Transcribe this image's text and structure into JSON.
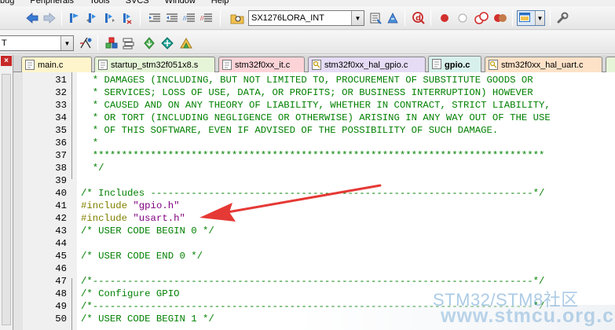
{
  "menu": {
    "items": [
      "bug",
      "Peripherals",
      "Tools",
      "SVCS",
      "Window",
      "Help"
    ]
  },
  "toolbar": {
    "target_combo": "SX1276LORA_INT",
    "left_combo": "T"
  },
  "tabs": [
    {
      "label": "main.c",
      "color": "#fff5cc"
    },
    {
      "label": "startup_stm32f051x8.s",
      "color": "#e6f5d8"
    },
    {
      "label": "stm32f0xx_it.c",
      "color": "#fcd4d8"
    },
    {
      "label": "stm32f0xx_hal_gpio.c",
      "color": "#e6dcf5"
    },
    {
      "label": "gpio.c",
      "color": "#d8f0ec",
      "active": true
    },
    {
      "label": "stm32f0xx_hal_uart.c",
      "color": "#fde2c8"
    }
  ],
  "editor": {
    "lines": [
      {
        "num": "31",
        "segs": [
          {
            "t": "  * DAMAGES (INCLUDING, BUT NOT LIMITED TO, PROCUREMENT OF SUBSTITUTE GOODS OR",
            "c": "comment"
          }
        ]
      },
      {
        "num": "32",
        "segs": [
          {
            "t": "  * SERVICES; LOSS OF USE, DATA, OR PROFITS; OR BUSINESS INTERRUPTION) HOWEVER",
            "c": "comment"
          }
        ]
      },
      {
        "num": "33",
        "segs": [
          {
            "t": "  * CAUSED AND ON ANY THEORY OF LIABILITY, WHETHER IN CONTRACT, STRICT LIABILITY,",
            "c": "comment"
          }
        ]
      },
      {
        "num": "34",
        "segs": [
          {
            "t": "  * OR TORT (INCLUDING NEGLIGENCE OR OTHERWISE) ARISING IN ANY WAY OUT OF THE USE",
            "c": "comment"
          }
        ]
      },
      {
        "num": "35",
        "segs": [
          {
            "t": "  * OF THIS SOFTWARE, EVEN IF ADVISED OF THE POSSIBILITY OF SUCH DAMAGE.",
            "c": "comment"
          }
        ]
      },
      {
        "num": "36",
        "segs": [
          {
            "t": "  *",
            "c": "comment"
          }
        ]
      },
      {
        "num": "37",
        "segs": [
          {
            "t": "  ******************************************************************************",
            "c": "comment"
          }
        ]
      },
      {
        "num": "38",
        "segs": [
          {
            "t": "  */",
            "c": "comment"
          }
        ]
      },
      {
        "num": "39",
        "segs": []
      },
      {
        "num": "40",
        "segs": [
          {
            "t": "/* Includes ------------------------------------------------------------------*/",
            "c": "comment"
          }
        ]
      },
      {
        "num": "41",
        "segs": [
          {
            "t": "#include ",
            "c": "pre"
          },
          {
            "t": "\"gpio.h\"",
            "c": "str"
          }
        ]
      },
      {
        "num": "42",
        "segs": [
          {
            "t": "#include ",
            "c": "pre"
          },
          {
            "t": "\"usart.h\"",
            "c": "str"
          }
        ]
      },
      {
        "num": "43",
        "segs": [
          {
            "t": "/* USER CODE BEGIN 0 */",
            "c": "comment"
          }
        ]
      },
      {
        "num": "44",
        "segs": []
      },
      {
        "num": "45",
        "segs": [
          {
            "t": "/* USER CODE END 0 */",
            "c": "comment"
          }
        ]
      },
      {
        "num": "46",
        "segs": []
      },
      {
        "num": "47",
        "segs": [
          {
            "t": "/*----------------------------------------------------------------------------*/",
            "c": "comment"
          }
        ]
      },
      {
        "num": "48",
        "segs": [
          {
            "t": "/* Configure GPIO",
            "c": "comment"
          }
        ]
      },
      {
        "num": "49",
        "segs": [
          {
            "t": "/*----------------------------------------------------------------------------*/",
            "c": "comment"
          }
        ]
      },
      {
        "num": "50",
        "segs": [
          {
            "t": "/* USER CODE BEGIN 1 */",
            "c": "comment"
          }
        ]
      }
    ]
  },
  "watermark": {
    "line1": "STM32/STM8社区",
    "line2": "www.stmcu.org.cn"
  },
  "colors": {
    "comment": "#008000",
    "preprocessor": "#808000",
    "string": "#800080",
    "arrow": "#e53935"
  },
  "icons": [
    "back-icon",
    "forward-icon",
    "bookmark-icon",
    "indent-icon",
    "unindent-icon",
    "comment-icon",
    "uncomment-icon",
    "find-in-files-icon",
    "debug-icon",
    "breakpoint-icon",
    "build-target-icon",
    "rebuild-icon",
    "download-icon",
    "wrench-icon",
    "manage-project-icon",
    "select-target-icon"
  ]
}
